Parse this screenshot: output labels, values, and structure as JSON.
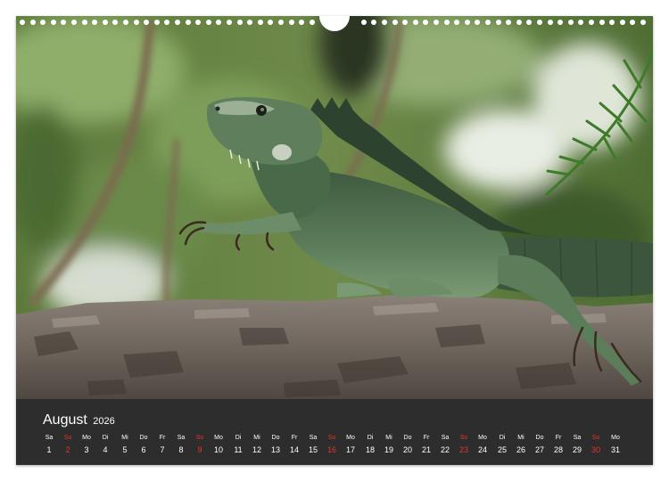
{
  "calendar": {
    "month": "August",
    "year": "2026",
    "days": [
      {
        "weekday": "Sa",
        "day": "1",
        "sunday": false
      },
      {
        "weekday": "So",
        "day": "2",
        "sunday": true
      },
      {
        "weekday": "Mo",
        "day": "3",
        "sunday": false
      },
      {
        "weekday": "Di",
        "day": "4",
        "sunday": false
      },
      {
        "weekday": "Mi",
        "day": "5",
        "sunday": false
      },
      {
        "weekday": "Do",
        "day": "6",
        "sunday": false
      },
      {
        "weekday": "Fr",
        "day": "7",
        "sunday": false
      },
      {
        "weekday": "Sa",
        "day": "8",
        "sunday": false
      },
      {
        "weekday": "So",
        "day": "9",
        "sunday": true
      },
      {
        "weekday": "Mo",
        "day": "10",
        "sunday": false
      },
      {
        "weekday": "Di",
        "day": "11",
        "sunday": false
      },
      {
        "weekday": "Mi",
        "day": "12",
        "sunday": false
      },
      {
        "weekday": "Do",
        "day": "13",
        "sunday": false
      },
      {
        "weekday": "Fr",
        "day": "14",
        "sunday": false
      },
      {
        "weekday": "Sa",
        "day": "15",
        "sunday": false
      },
      {
        "weekday": "So",
        "day": "16",
        "sunday": true
      },
      {
        "weekday": "Mo",
        "day": "17",
        "sunday": false
      },
      {
        "weekday": "Di",
        "day": "18",
        "sunday": false
      },
      {
        "weekday": "Mi",
        "day": "19",
        "sunday": false
      },
      {
        "weekday": "Do",
        "day": "20",
        "sunday": false
      },
      {
        "weekday": "Fr",
        "day": "21",
        "sunday": false
      },
      {
        "weekday": "Sa",
        "day": "22",
        "sunday": false
      },
      {
        "weekday": "So",
        "day": "23",
        "sunday": true
      },
      {
        "weekday": "Mo",
        "day": "24",
        "sunday": false
      },
      {
        "weekday": "Di",
        "day": "25",
        "sunday": false
      },
      {
        "weekday": "Mi",
        "day": "26",
        "sunday": false
      },
      {
        "weekday": "Do",
        "day": "27",
        "sunday": false
      },
      {
        "weekday": "Fr",
        "day": "28",
        "sunday": false
      },
      {
        "weekday": "Sa",
        "day": "29",
        "sunday": false
      },
      {
        "weekday": "So",
        "day": "30",
        "sunday": true
      },
      {
        "weekday": "Mo",
        "day": "31",
        "sunday": false
      }
    ]
  },
  "colors": {
    "grid_background": "#2d2d2d",
    "text": "#ffffff",
    "sunday": "#e3342f"
  }
}
